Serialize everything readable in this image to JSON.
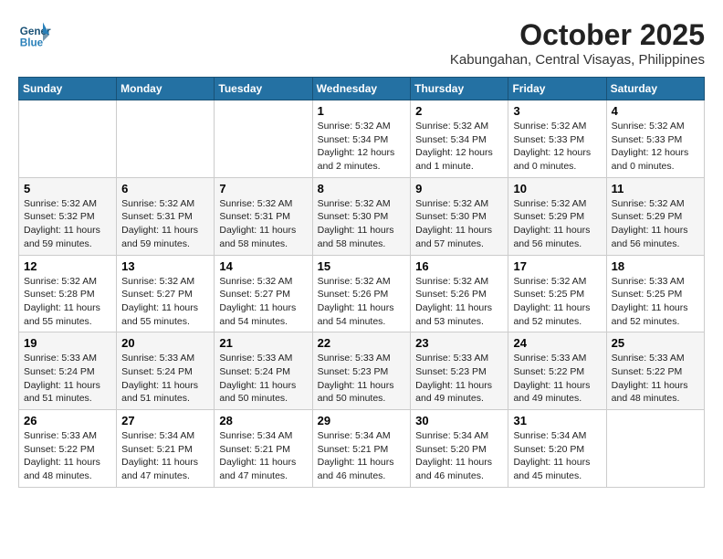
{
  "header": {
    "logo_line1": "General",
    "logo_line2": "Blue",
    "month_title": "October 2025",
    "location": "Kabungahan, Central Visayas, Philippines"
  },
  "weekdays": [
    "Sunday",
    "Monday",
    "Tuesday",
    "Wednesday",
    "Thursday",
    "Friday",
    "Saturday"
  ],
  "weeks": [
    [
      {
        "day": "",
        "info": ""
      },
      {
        "day": "",
        "info": ""
      },
      {
        "day": "",
        "info": ""
      },
      {
        "day": "1",
        "info": "Sunrise: 5:32 AM\nSunset: 5:34 PM\nDaylight: 12 hours\nand 2 minutes."
      },
      {
        "day": "2",
        "info": "Sunrise: 5:32 AM\nSunset: 5:34 PM\nDaylight: 12 hours\nand 1 minute."
      },
      {
        "day": "3",
        "info": "Sunrise: 5:32 AM\nSunset: 5:33 PM\nDaylight: 12 hours\nand 0 minutes."
      },
      {
        "day": "4",
        "info": "Sunrise: 5:32 AM\nSunset: 5:33 PM\nDaylight: 12 hours\nand 0 minutes."
      }
    ],
    [
      {
        "day": "5",
        "info": "Sunrise: 5:32 AM\nSunset: 5:32 PM\nDaylight: 11 hours\nand 59 minutes."
      },
      {
        "day": "6",
        "info": "Sunrise: 5:32 AM\nSunset: 5:31 PM\nDaylight: 11 hours\nand 59 minutes."
      },
      {
        "day": "7",
        "info": "Sunrise: 5:32 AM\nSunset: 5:31 PM\nDaylight: 11 hours\nand 58 minutes."
      },
      {
        "day": "8",
        "info": "Sunrise: 5:32 AM\nSunset: 5:30 PM\nDaylight: 11 hours\nand 58 minutes."
      },
      {
        "day": "9",
        "info": "Sunrise: 5:32 AM\nSunset: 5:30 PM\nDaylight: 11 hours\nand 57 minutes."
      },
      {
        "day": "10",
        "info": "Sunrise: 5:32 AM\nSunset: 5:29 PM\nDaylight: 11 hours\nand 56 minutes."
      },
      {
        "day": "11",
        "info": "Sunrise: 5:32 AM\nSunset: 5:29 PM\nDaylight: 11 hours\nand 56 minutes."
      }
    ],
    [
      {
        "day": "12",
        "info": "Sunrise: 5:32 AM\nSunset: 5:28 PM\nDaylight: 11 hours\nand 55 minutes."
      },
      {
        "day": "13",
        "info": "Sunrise: 5:32 AM\nSunset: 5:27 PM\nDaylight: 11 hours\nand 55 minutes."
      },
      {
        "day": "14",
        "info": "Sunrise: 5:32 AM\nSunset: 5:27 PM\nDaylight: 11 hours\nand 54 minutes."
      },
      {
        "day": "15",
        "info": "Sunrise: 5:32 AM\nSunset: 5:26 PM\nDaylight: 11 hours\nand 54 minutes."
      },
      {
        "day": "16",
        "info": "Sunrise: 5:32 AM\nSunset: 5:26 PM\nDaylight: 11 hours\nand 53 minutes."
      },
      {
        "day": "17",
        "info": "Sunrise: 5:32 AM\nSunset: 5:25 PM\nDaylight: 11 hours\nand 52 minutes."
      },
      {
        "day": "18",
        "info": "Sunrise: 5:33 AM\nSunset: 5:25 PM\nDaylight: 11 hours\nand 52 minutes."
      }
    ],
    [
      {
        "day": "19",
        "info": "Sunrise: 5:33 AM\nSunset: 5:24 PM\nDaylight: 11 hours\nand 51 minutes."
      },
      {
        "day": "20",
        "info": "Sunrise: 5:33 AM\nSunset: 5:24 PM\nDaylight: 11 hours\nand 51 minutes."
      },
      {
        "day": "21",
        "info": "Sunrise: 5:33 AM\nSunset: 5:24 PM\nDaylight: 11 hours\nand 50 minutes."
      },
      {
        "day": "22",
        "info": "Sunrise: 5:33 AM\nSunset: 5:23 PM\nDaylight: 11 hours\nand 50 minutes."
      },
      {
        "day": "23",
        "info": "Sunrise: 5:33 AM\nSunset: 5:23 PM\nDaylight: 11 hours\nand 49 minutes."
      },
      {
        "day": "24",
        "info": "Sunrise: 5:33 AM\nSunset: 5:22 PM\nDaylight: 11 hours\nand 49 minutes."
      },
      {
        "day": "25",
        "info": "Sunrise: 5:33 AM\nSunset: 5:22 PM\nDaylight: 11 hours\nand 48 minutes."
      }
    ],
    [
      {
        "day": "26",
        "info": "Sunrise: 5:33 AM\nSunset: 5:22 PM\nDaylight: 11 hours\nand 48 minutes."
      },
      {
        "day": "27",
        "info": "Sunrise: 5:34 AM\nSunset: 5:21 PM\nDaylight: 11 hours\nand 47 minutes."
      },
      {
        "day": "28",
        "info": "Sunrise: 5:34 AM\nSunset: 5:21 PM\nDaylight: 11 hours\nand 47 minutes."
      },
      {
        "day": "29",
        "info": "Sunrise: 5:34 AM\nSunset: 5:21 PM\nDaylight: 11 hours\nand 46 minutes."
      },
      {
        "day": "30",
        "info": "Sunrise: 5:34 AM\nSunset: 5:20 PM\nDaylight: 11 hours\nand 46 minutes."
      },
      {
        "day": "31",
        "info": "Sunrise: 5:34 AM\nSunset: 5:20 PM\nDaylight: 11 hours\nand 45 minutes."
      },
      {
        "day": "",
        "info": ""
      }
    ]
  ]
}
